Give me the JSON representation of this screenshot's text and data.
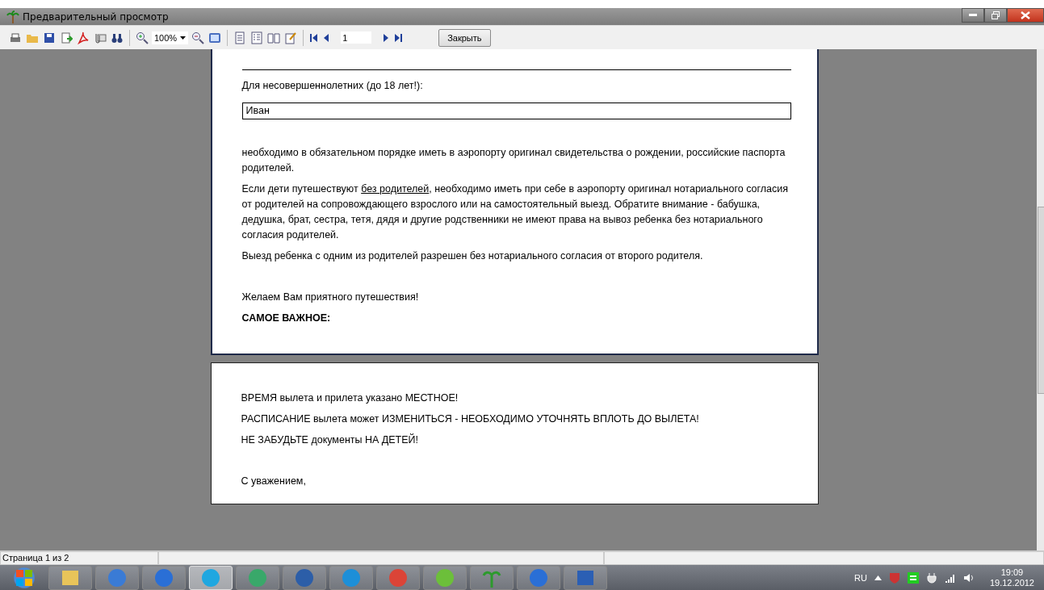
{
  "window": {
    "title": "Предварительный просмотр"
  },
  "toolbar": {
    "zoom": "100%",
    "page_input": "1",
    "close_button": "Закрыть"
  },
  "pages": [
    {
      "sections": [
        [
          {
            "kind": "label",
            "text": "Для несовершеннолетних (до 18 лет!):"
          },
          {
            "kind": "field",
            "text": "Иван"
          }
        ],
        [
          {
            "kind": "paragraph",
            "text": "необходимо в обязательном порядке иметь в аэропорту оригинал свидетельства о рождении, российские паспорта родителей."
          },
          {
            "kind": "linked",
            "before": "Если дети путешествуют ",
            "link": "без родителей",
            "after": ", необходимо иметь при себе в аэропорту оригинал нотариального согласия от родителей на сопровождающего взрослого или на самостоятельный выезд. Обратите внимание - бабушка, дедушка, брат, сестра, тетя, дядя и другие родственники не имеют права на вывоз ребенка без нотариального согласия родителей."
          },
          {
            "kind": "paragraph",
            "text": "Выезд ребенка с одним из родителей разрешен без нотариального согласия от второго родителя."
          }
        ],
        [
          {
            "kind": "paragraph",
            "text": "Желаем Вам приятного путешествия!"
          },
          {
            "kind": "bold",
            "text": "САМОЕ ВАЖНОЕ:"
          }
        ]
      ]
    },
    {
      "sections": [
        [
          {
            "kind": "paragraph",
            "text": "ВРЕМЯ вылета и прилета указано МЕСТНОЕ!"
          },
          {
            "kind": "paragraph",
            "text": "РАСПИСАНИЕ вылета может ИЗМЕНИТЬСЯ - НЕОБХОДИМО УТОЧНЯТЬ ВПЛОТЬ ДО ВЫЛЕТА!"
          },
          {
            "kind": "paragraph",
            "text": "НЕ ЗАБУДЬТЕ документы НА ДЕТЕЙ!"
          }
        ],
        [
          {
            "kind": "paragraph",
            "text": "С уважением,"
          }
        ]
      ]
    }
  ],
  "status_bar": {
    "page_info": "Страница 1 из 2"
  },
  "taskbar": {
    "apps": [
      {
        "kind": "folder",
        "selected": false
      },
      {
        "kind": "bird",
        "selected": false
      },
      {
        "kind": "ie",
        "selected": false
      },
      {
        "kind": "skype",
        "selected": true
      },
      {
        "kind": "wave",
        "selected": false
      },
      {
        "kind": "mail",
        "selected": false
      },
      {
        "kind": "remote",
        "selected": false
      },
      {
        "kind": "chrome",
        "selected": false
      },
      {
        "kind": "meter",
        "selected": false
      },
      {
        "kind": "palm",
        "selected": false
      },
      {
        "kind": "ie",
        "selected": false
      },
      {
        "kind": "word",
        "selected": false
      }
    ],
    "language": "RU",
    "time": "19:09",
    "date": "19.12.2012"
  }
}
